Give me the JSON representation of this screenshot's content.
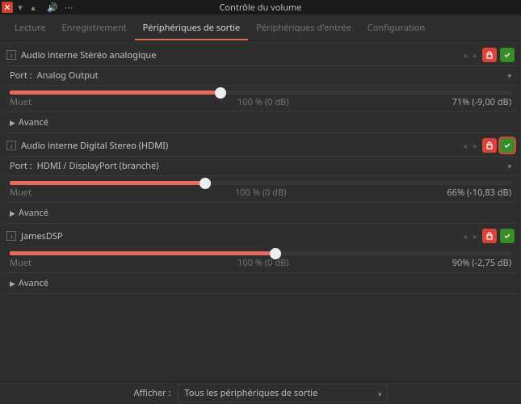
{
  "window": {
    "title": "Contrôle du volume"
  },
  "tabs": {
    "items": [
      {
        "label": "Lecture"
      },
      {
        "label": "Enregistrement"
      },
      {
        "label": "Périphériques de sortie"
      },
      {
        "label": "Périphériques d'entrée"
      },
      {
        "label": "Configuration"
      }
    ],
    "active_index": 2
  },
  "labels": {
    "port": "Port :",
    "mute": "Muet",
    "advanced": "Avancé",
    "show": "Afficher :"
  },
  "devices": [
    {
      "name": "Audio interne Stéréo analogique",
      "has_port": true,
      "port": "Analog Output",
      "slider_percent": 42,
      "center_text": "100 % (0 dB)",
      "right_text": "71% (-9,00 dB)",
      "default_active": false
    },
    {
      "name": "Audio interne Digital Stereo (HDMI)",
      "has_port": true,
      "port": "HDMI / DisplayPort (branché)",
      "slider_percent": 39,
      "center_text": "100 % (0 dB)",
      "right_text": "66% (-10,83 dB)",
      "default_active": true
    },
    {
      "name": "JamesDSP",
      "has_port": false,
      "port": "",
      "slider_percent": 53,
      "center_text": "100 % (0 dB)",
      "right_text": "90% (-2,75 dB)",
      "default_active": false
    }
  ],
  "footer": {
    "selected": "Tous les périphériques de sortie"
  }
}
